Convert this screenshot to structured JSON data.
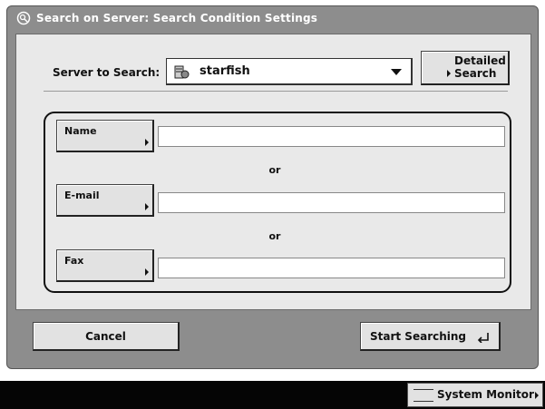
{
  "title": "Search on Server: Search Condition Settings",
  "server": {
    "label": "Server to Search:",
    "selected": "starfish",
    "detailed_search_label_line1": "Detailed",
    "detailed_search_label_line2": "Search"
  },
  "conditions": [
    {
      "label": "Name",
      "value": ""
    },
    {
      "label": "E-mail",
      "value": ""
    },
    {
      "label": "Fax",
      "value": ""
    }
  ],
  "or_text": "or",
  "buttons": {
    "cancel": "Cancel",
    "start": "Start Searching"
  },
  "status_bar": {
    "system_monitor": "System Monitor"
  }
}
